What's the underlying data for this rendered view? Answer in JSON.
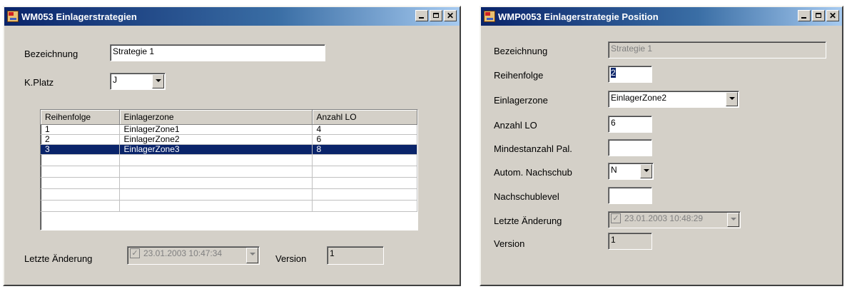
{
  "win1": {
    "title": "WM053 Einlagerstrategien",
    "bezeichnung_label": "Bezeichnung",
    "bezeichnung_value": "Strategie 1",
    "kplatz_label": "K.Platz",
    "kplatz_value": "J",
    "table": {
      "headers": [
        "Reihenfolge",
        "Einlagerzone",
        "Anzahl LO"
      ],
      "rows": [
        [
          "1",
          "EinlagerZone1",
          "4"
        ],
        [
          "2",
          "EinlagerZone2",
          "6"
        ],
        [
          "3",
          "EinlagerZone3",
          "8"
        ]
      ],
      "selected_row": 3
    },
    "letzte_label": "Letzte Änderung",
    "letzte_value": "23.01.2003 10:47:34",
    "version_label": "Version",
    "version_value": "1"
  },
  "win2": {
    "title": "WMP0053 Einlagerstrategie Position",
    "bezeichnung_label": "Bezeichnung",
    "bezeichnung_value": "Strategie 1",
    "reihenfolge_label": "Reihenfolge",
    "reihenfolge_value": "2",
    "einlagerzone_label": "Einlagerzone",
    "einlagerzone_value": "EinlagerZone2",
    "anzahl_label": "Anzahl LO",
    "anzahl_value": "6",
    "mindest_label": "Mindestanzahl Pal.",
    "mindest_value": "",
    "autom_label": "Autom. Nachschub",
    "autom_value": "N",
    "nachschub_label": "Nachschublevel",
    "nachschub_value": "",
    "letzte_label": "Letzte Änderung",
    "letzte_value": "23.01.2003 10:48:29",
    "version_label": "Version",
    "version_value": "1"
  },
  "colors": {
    "window_bg": "#d4d0c8",
    "titlebar_start": "#0a246a",
    "selection": "#0a246a"
  },
  "icons": [
    "app-icon",
    "minimize-icon",
    "maximize-icon",
    "close-icon",
    "dropdown-arrow-icon",
    "checkbox-checked-icon"
  ]
}
